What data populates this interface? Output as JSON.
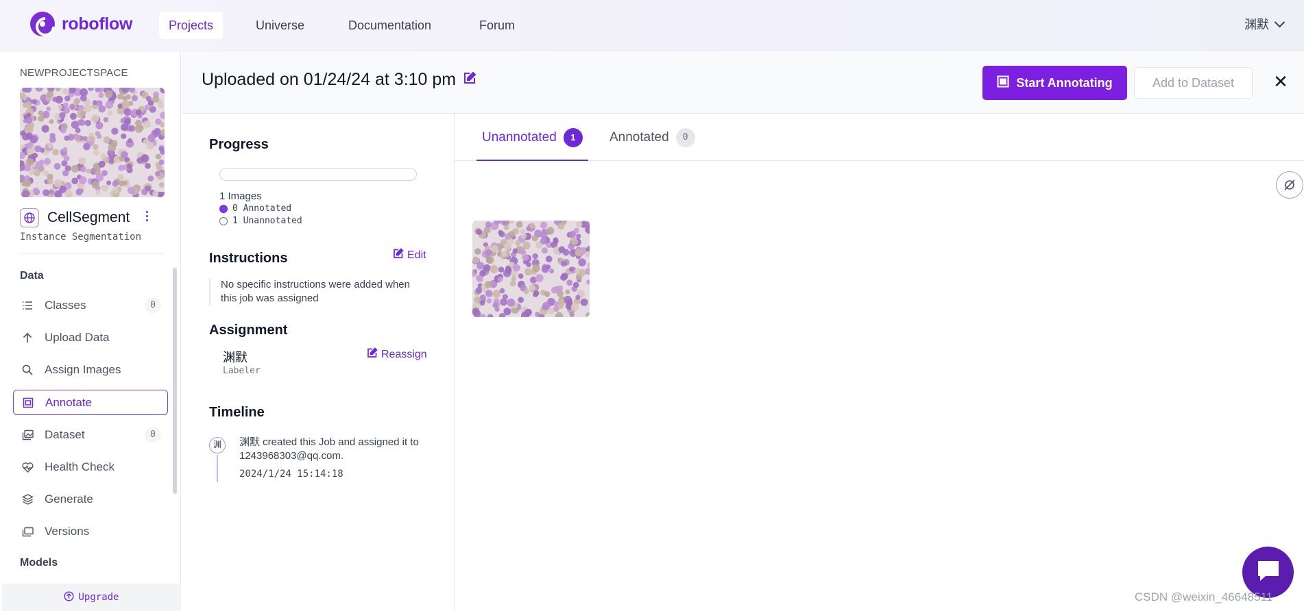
{
  "brand": {
    "name": "roboflow",
    "color": "#7b2cd6"
  },
  "nav": {
    "items": [
      {
        "label": "Projects",
        "active": true
      },
      {
        "label": "Universe",
        "active": false
      },
      {
        "label": "Documentation",
        "active": false
      },
      {
        "label": "Forum",
        "active": false
      }
    ],
    "user": "渊默"
  },
  "sidebar": {
    "workspace": "NEWPROJECTSPACE",
    "project": {
      "name": "CellSegment",
      "type": "Instance Segmentation",
      "icon": "globe-icon"
    },
    "sections": {
      "data_title": "Data",
      "models_title": "Models"
    },
    "items": [
      {
        "label": "Classes",
        "icon": "list-icon",
        "count": "0",
        "active": false
      },
      {
        "label": "Upload Data",
        "icon": "arrow-up-icon",
        "active": false
      },
      {
        "label": "Assign Images",
        "icon": "search-icon",
        "active": false
      },
      {
        "label": "Annotate",
        "icon": "annotate-icon",
        "active": true
      },
      {
        "label": "Dataset",
        "icon": "images-icon",
        "count": "0",
        "active": false
      },
      {
        "label": "Health Check",
        "icon": "heart-pulse-icon",
        "active": false
      },
      {
        "label": "Generate",
        "icon": "layers-icon",
        "active": false
      },
      {
        "label": "Versions",
        "icon": "folders-icon",
        "active": false
      }
    ],
    "upgrade_label": "Upgrade"
  },
  "header": {
    "title": "Uploaded on 01/24/24 at 3:10 pm",
    "start_label": "Start Annotating",
    "add_label": "Add to Dataset",
    "accent": "#7c1fe0"
  },
  "detail": {
    "progress_title": "Progress",
    "annotated_fraction": 0,
    "images_label": "1 Images",
    "annotated_label": "0 Annotated",
    "unannotated_label": "1 Unannotated",
    "instructions_title": "Instructions",
    "edit_label": "Edit",
    "instructions_text": "No specific instructions were added when this job was assigned",
    "assignment_title": "Assignment",
    "reassign_label": "Reassign",
    "assignee_name": "渊默",
    "assignee_role": "Labeler",
    "timeline_title": "Timeline",
    "timeline_avatar": "渊",
    "timeline_text": "渊默 created this Job and assigned it to 1243968303@qq.com.",
    "timeline_time": "2024/1/24 15:14:18"
  },
  "tabs": [
    {
      "label": "Unannotated",
      "count": "1",
      "active": true
    },
    {
      "label": "Annotated",
      "count": "0",
      "active": false
    }
  ],
  "watermark": "CSDN @weixin_46648511"
}
